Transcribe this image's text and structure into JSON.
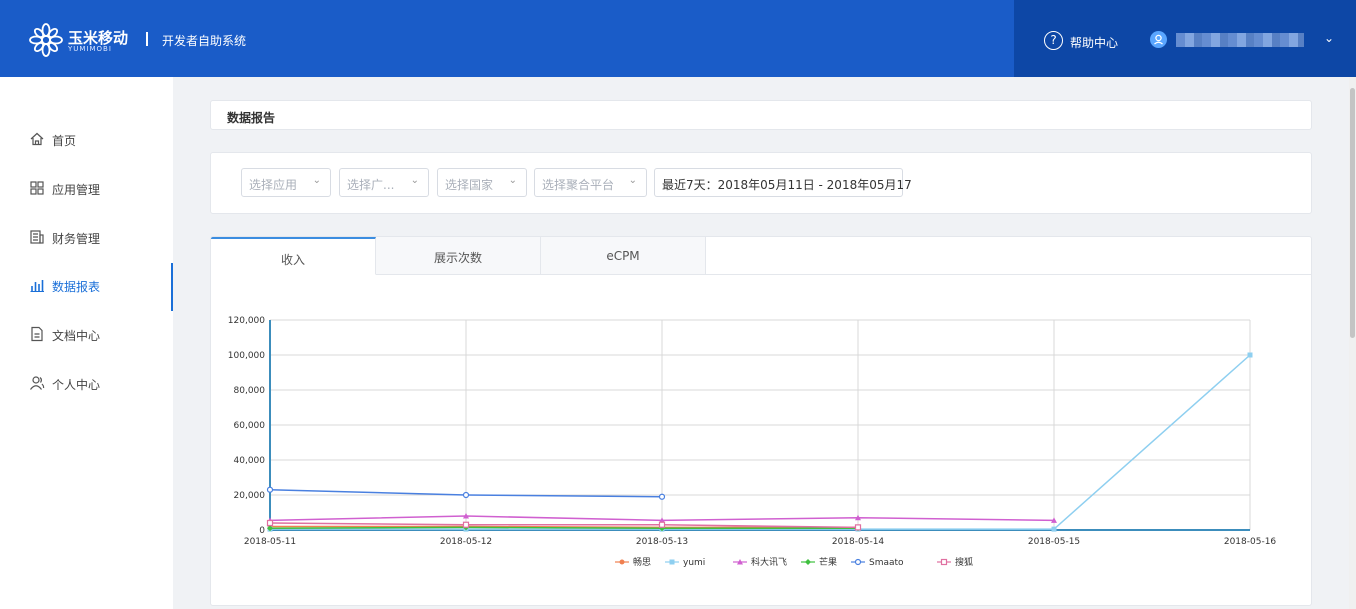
{
  "header": {
    "logo_text": "玉米移动",
    "logo_sub": "YUMIMOBI",
    "system_title": "开发者自助系统",
    "help_label": "帮助中心",
    "help_glyph": "?",
    "chevron": "⌄"
  },
  "sidebar": {
    "items": [
      {
        "label": "首页",
        "icon": "home-icon"
      },
      {
        "label": "应用管理",
        "icon": "grid-icon"
      },
      {
        "label": "财务管理",
        "icon": "finance-icon"
      },
      {
        "label": "数据报表",
        "icon": "bar-chart-icon",
        "active": true
      },
      {
        "label": "文档中心",
        "icon": "document-icon"
      },
      {
        "label": "个人中心",
        "icon": "user-icon"
      }
    ]
  },
  "main": {
    "page_title": "数据报告",
    "filters": {
      "app": "选择应用",
      "ad": "选择广...",
      "country": "选择国家",
      "platform": "选择聚合平台",
      "date_range": "最近7天：2018年05月11日 - 2018年05月17"
    },
    "tabs": [
      {
        "label": "收入",
        "active": true
      },
      {
        "label": "展示次数"
      },
      {
        "label": "eCPM"
      }
    ]
  },
  "chart_data": {
    "type": "line",
    "x": [
      "2018-05-11",
      "2018-05-12",
      "2018-05-13",
      "2018-05-14",
      "2018-05-15",
      "2018-05-16"
    ],
    "ylim": [
      0,
      120000
    ],
    "yticks": [
      "0",
      "20,000",
      "40,000",
      "60,000",
      "80,000",
      "100,000",
      "120,000"
    ],
    "grid": true,
    "legend_position": "bottom",
    "series": [
      {
        "name": "畅思",
        "color": "#f08050",
        "marker": "circle",
        "values": [
          2000,
          2000,
          1500,
          1500,
          null,
          null
        ]
      },
      {
        "name": "yumi",
        "color": "#8ecff0",
        "marker": "square",
        "values": [
          500,
          500,
          500,
          500,
          500,
          100000
        ]
      },
      {
        "name": "科大讯飞",
        "color": "#d060d0",
        "marker": "triangle",
        "values": [
          5500,
          8000,
          5500,
          7000,
          5500,
          null
        ]
      },
      {
        "name": "芒果",
        "color": "#40c040",
        "marker": "diamond",
        "values": [
          1000,
          1500,
          1000,
          1000,
          null,
          null
        ]
      },
      {
        "name": "Smaato",
        "color": "#4a80e0",
        "marker": "circle-open",
        "values": [
          23000,
          20000,
          19000,
          null,
          null,
          null
        ]
      },
      {
        "name": "搜狐",
        "color": "#e070a0",
        "marker": "square-open",
        "values": [
          4000,
          3000,
          3000,
          1500,
          null,
          null
        ]
      }
    ]
  }
}
